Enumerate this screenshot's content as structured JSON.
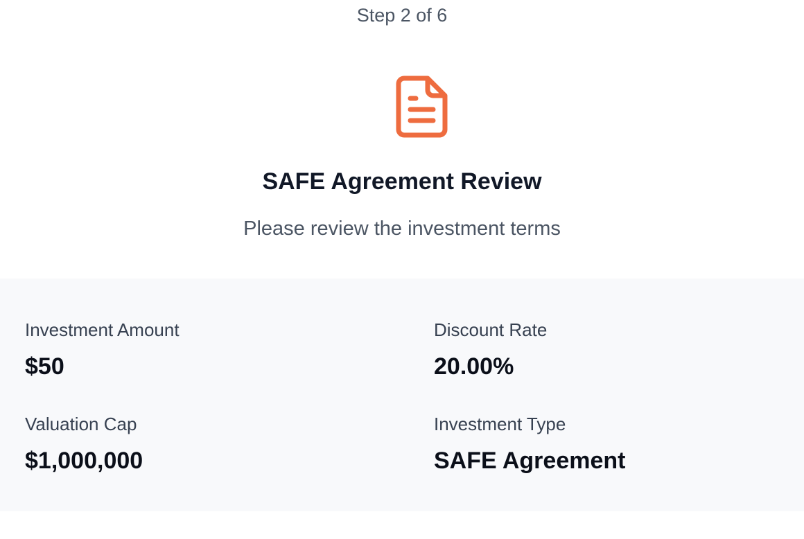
{
  "header": {
    "step_text": "Step 2 of 6",
    "icon": "document-text-icon",
    "accent_color": "#ee6c3f",
    "title": "SAFE Agreement Review",
    "subtitle": "Please review the investment terms"
  },
  "terms": {
    "investment_amount": {
      "label": "Investment Amount",
      "value": "$50"
    },
    "discount_rate": {
      "label": "Discount Rate",
      "value": "20.00%"
    },
    "valuation_cap": {
      "label": "Valuation Cap",
      "value": "$1,000,000"
    },
    "investment_type": {
      "label": "Investment Type",
      "value": "SAFE Agreement"
    }
  }
}
